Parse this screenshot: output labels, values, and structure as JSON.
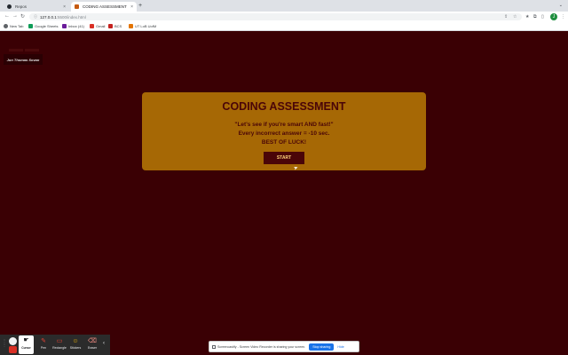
{
  "browser": {
    "tabs": [
      {
        "title": "Repos",
        "close": "×"
      },
      {
        "title": "CODING ASSESSMENT",
        "close": "×"
      }
    ],
    "new_tab_glyph": "+",
    "tabs_menu_glyph": "⌄",
    "url": {
      "host": "127.0.0.1",
      "path": ":5500/index.html"
    },
    "profile_initial": "J",
    "bookmarks": [
      {
        "label": "New Tab",
        "icon": "globe-icon",
        "color": "#5f6368"
      },
      {
        "label": "Google Sheets",
        "icon": "sheets-icon",
        "color": "#0f9d58"
      },
      {
        "label": "Inbox (41)",
        "icon": "inbox-icon",
        "color": "#6a1b9a"
      },
      {
        "label": "Gmail",
        "icon": "gmail-icon",
        "color": "#d93025"
      },
      {
        "label": "BCS",
        "icon": "bcs-icon",
        "color": "#c5221f"
      },
      {
        "label": "UT LoB UofM",
        "icon": "ut-icon",
        "color": "#e37400"
      }
    ]
  },
  "page": {
    "author": "Jon Thomas Sovan",
    "card": {
      "title": "CODING ASSESSMENT",
      "lines": [
        "\"Let's see if you're smart AND fast!\"",
        "Every incorrect answer = -10 sec.",
        "BEST OF LUCK!"
      ],
      "start_label": "START"
    },
    "colors": {
      "background": "#3a0004",
      "card": "#a66805",
      "accent": "#4a0508",
      "button_text": "#ffd37a"
    }
  },
  "screencastify": {
    "tools": [
      {
        "label": "Pen",
        "glyph": "✎",
        "color": "#ea4335"
      },
      {
        "label": "Rectangle",
        "glyph": "▭",
        "color": "#ea4335"
      },
      {
        "label": "Stickers",
        "glyph": "☺",
        "color": "#fbbc04"
      },
      {
        "label": "Eraser",
        "glyph": "⌫",
        "color": "#f28b82"
      }
    ],
    "active_tool_label": "Cursor",
    "share_notice": "Screencastify - Screen Video Recorder is sharing your screen.",
    "stop_label": "Stop sharing",
    "hide_label": "Hide"
  }
}
